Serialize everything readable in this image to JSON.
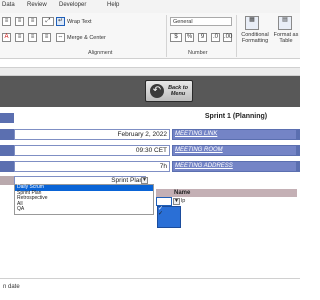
{
  "ribbon": {
    "tabs": [
      "Data",
      "Review",
      "Developer",
      "Help"
    ],
    "wrap_text": "Wrap Text",
    "merge_center": "Merge & Center",
    "number_format": "General",
    "alignment_label": "Alignment",
    "number_label": "Number",
    "conditional_formatting": "Conditional Formatting",
    "format_as_table": "Format as Table",
    "percent_symbol": "%",
    "comma_symbol": "9"
  },
  "banner": {
    "back_line1": "Back to",
    "back_line2": "Menu"
  },
  "sheet": {
    "title": "Sprint 1 (Planning)",
    "rows": [
      {
        "value": "February 2, 2022",
        "link": "MEETING LINK"
      },
      {
        "value": "09:30 CET",
        "link": "MEETING ROOM"
      },
      {
        "value": "7h",
        "link": "MEETING ADDRESS"
      }
    ],
    "selected_value": "Sprint Plan",
    "dropdown_options": [
      {
        "label": "Daily Scrum",
        "selected": true
      },
      {
        "label": "Sprint Plan",
        "selected": false
      },
      {
        "label": "Retrospective",
        "selected": false
      },
      {
        "label": "All",
        "selected": false
      },
      {
        "label": "QA",
        "selected": false
      }
    ],
    "name_header": "Name",
    "name_cell_value": "lp",
    "footer_label": "n date"
  },
  "colors": {
    "banner": "#585858",
    "accent_blue": "#5b6fb0",
    "link_fill": "#7484c6",
    "header_mauve": "#c4b0b5",
    "selection_blue": "#0a64d6"
  }
}
